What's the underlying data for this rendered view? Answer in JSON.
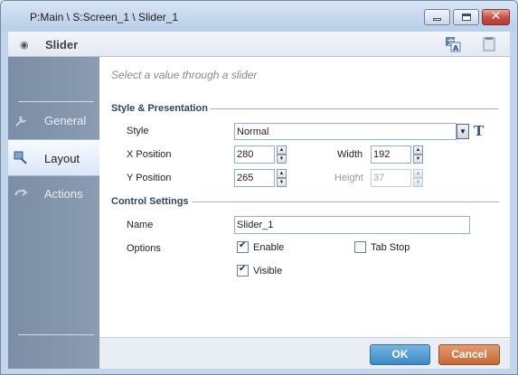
{
  "window": {
    "title": "P:Main \\ S:Screen_1 \\ Slider_1",
    "minimize_icon": "minimize-icon",
    "maximize_icon": "maximize-icon",
    "close_icon": "close-icon"
  },
  "header": {
    "title": "Slider",
    "icons": [
      "eye-icon",
      "translate-icon",
      "document-icon"
    ]
  },
  "sidebar": {
    "items": [
      {
        "label": "General",
        "icon": "wrench-icon",
        "active": false
      },
      {
        "label": "Layout",
        "icon": "layout-icon",
        "active": true
      },
      {
        "label": "Actions",
        "icon": "actions-icon",
        "active": false
      }
    ]
  },
  "content": {
    "hint": "Select a value through a slider",
    "style_section": {
      "title": "Style & Presentation",
      "style_label": "Style",
      "style_value": "Normal",
      "x_label": "X Position",
      "x_value": "280",
      "width_label": "Width",
      "width_value": "192",
      "y_label": "Y Position",
      "y_value": "265",
      "height_label": "Height",
      "height_value": "37"
    },
    "control_section": {
      "title": "Control Settings",
      "name_label": "Name",
      "name_value": "Slider_1",
      "options_label": "Options",
      "enable_label": "Enable",
      "enable_checked": true,
      "tabstop_label": "Tab Stop",
      "tabstop_checked": false,
      "visible_label": "Visible",
      "visible_checked": true
    }
  },
  "footer": {
    "ok_label": "OK",
    "cancel_label": "Cancel"
  },
  "colors": {
    "ok_button": "#3d8ac8",
    "cancel_button": "#c7683a",
    "section_title": "#2f4562",
    "sidebar": "#8a9cb1"
  }
}
